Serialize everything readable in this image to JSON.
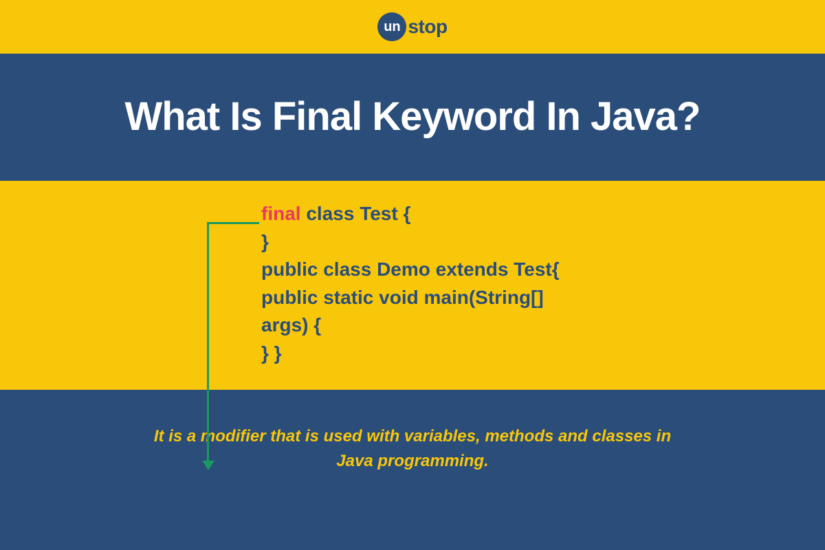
{
  "logo": {
    "circle_text": "un",
    "text": "stop"
  },
  "title": "What Is Final Keyword In Java?",
  "code": {
    "keyword": "final",
    "line1_rest": " class Test {",
    "line2": "}",
    "line3": "public class Demo extends Test{",
    "line4": "public static void main(String[]",
    "line5": "args) {",
    "line6": "} }"
  },
  "annotation": "It is a modifier that is used with variables, methods and classes in Java programming."
}
